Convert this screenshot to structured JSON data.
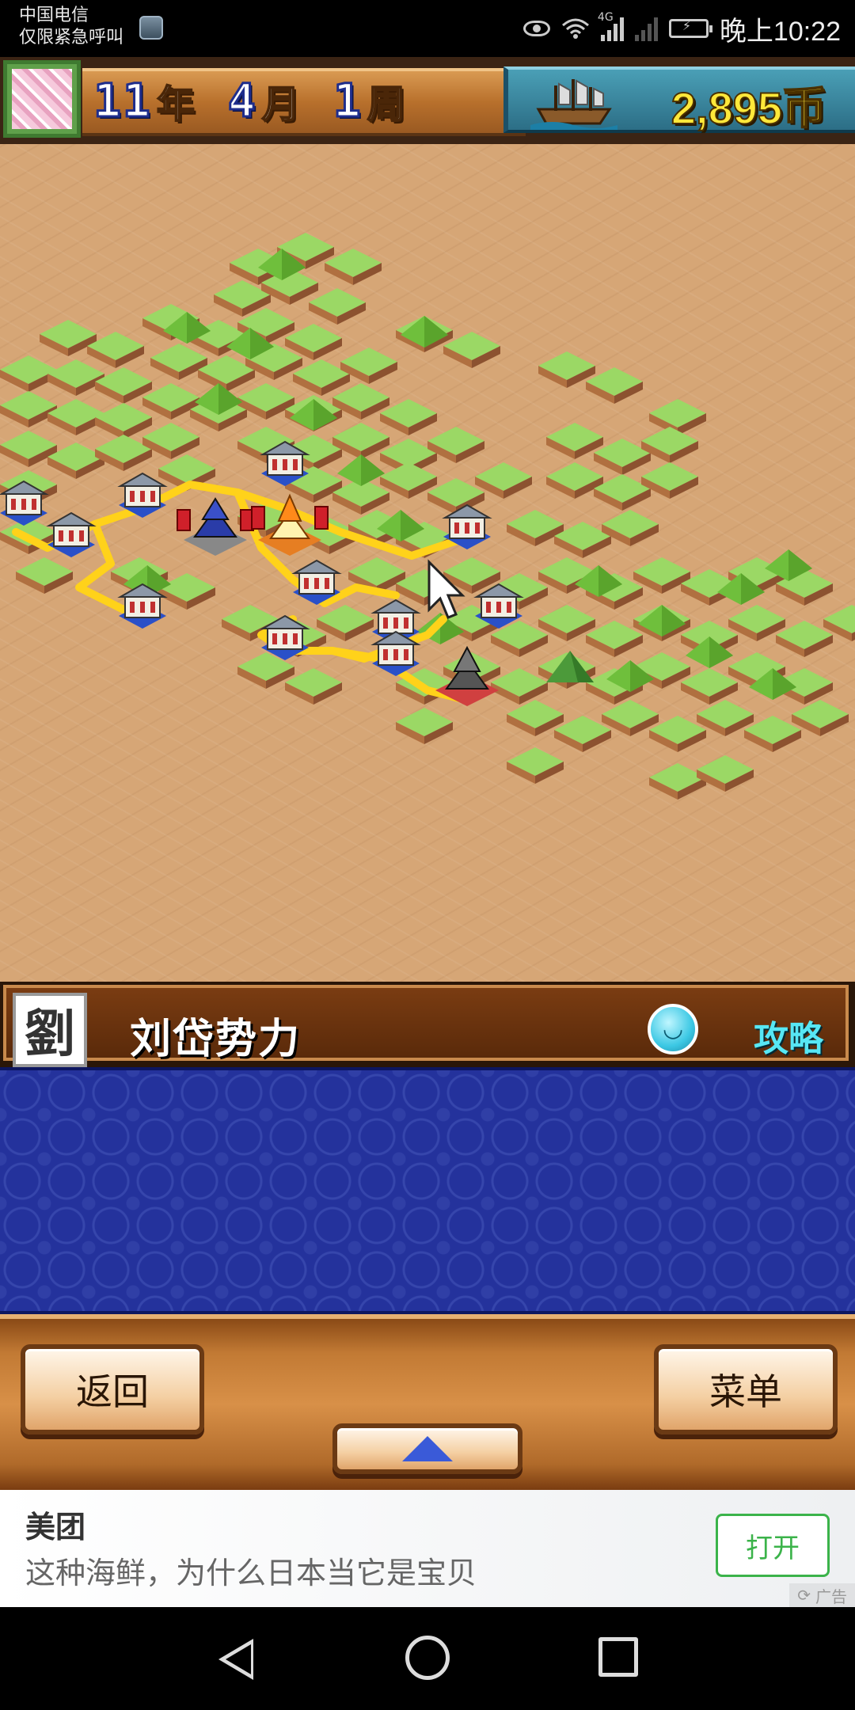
{
  "status_bar": {
    "carrier": "中国电信",
    "carrier_sub": "仅限紧急呼叫",
    "network": "4G",
    "time": "晚上10:22"
  },
  "hud": {
    "year_num": "11",
    "year_unit": "年",
    "month_num": "4",
    "month_unit": "月",
    "week_num": "1",
    "week_unit": "周",
    "coins": "2,895币"
  },
  "faction": {
    "seal_char": "劉",
    "name": "刘岱势力",
    "strategy_label": "攻略"
  },
  "controls": {
    "back_label": "返回",
    "menu_label": "菜单"
  },
  "ad": {
    "brand": "美团",
    "text": "这种海鲜，为什么日本当它是宝贝",
    "open_label": "打开",
    "tag": "广告"
  },
  "colors": {
    "sand": "#d6a676",
    "grass": "#8ccf5a",
    "road": "#ffd21a",
    "panel_blue": "#24329c",
    "accent_cyan": "#57e7f4",
    "coin_yellow": "#ffe83a"
  }
}
